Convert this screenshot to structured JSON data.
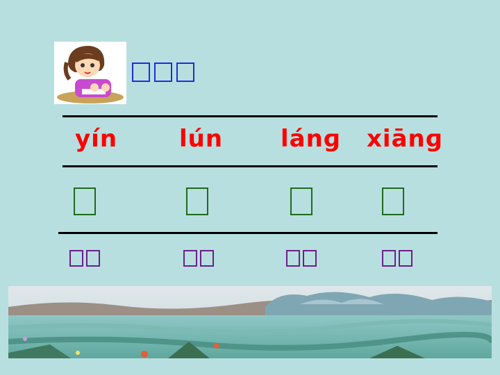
{
  "pinyin": {
    "w1": "yín",
    "w2": "lún",
    "w3": "lánɡ",
    "w4": "xiānɡ"
  },
  "colors": {
    "background": "#b8dfe0",
    "pinyin": "#ff0000",
    "title_glyph": "#1a2fd8",
    "char_box": "#1d6a1d",
    "word_glyph": "#6a1f8a"
  },
  "icons": {
    "avatar": "girl-writing-illustration",
    "scene": "landscape-illustration"
  }
}
